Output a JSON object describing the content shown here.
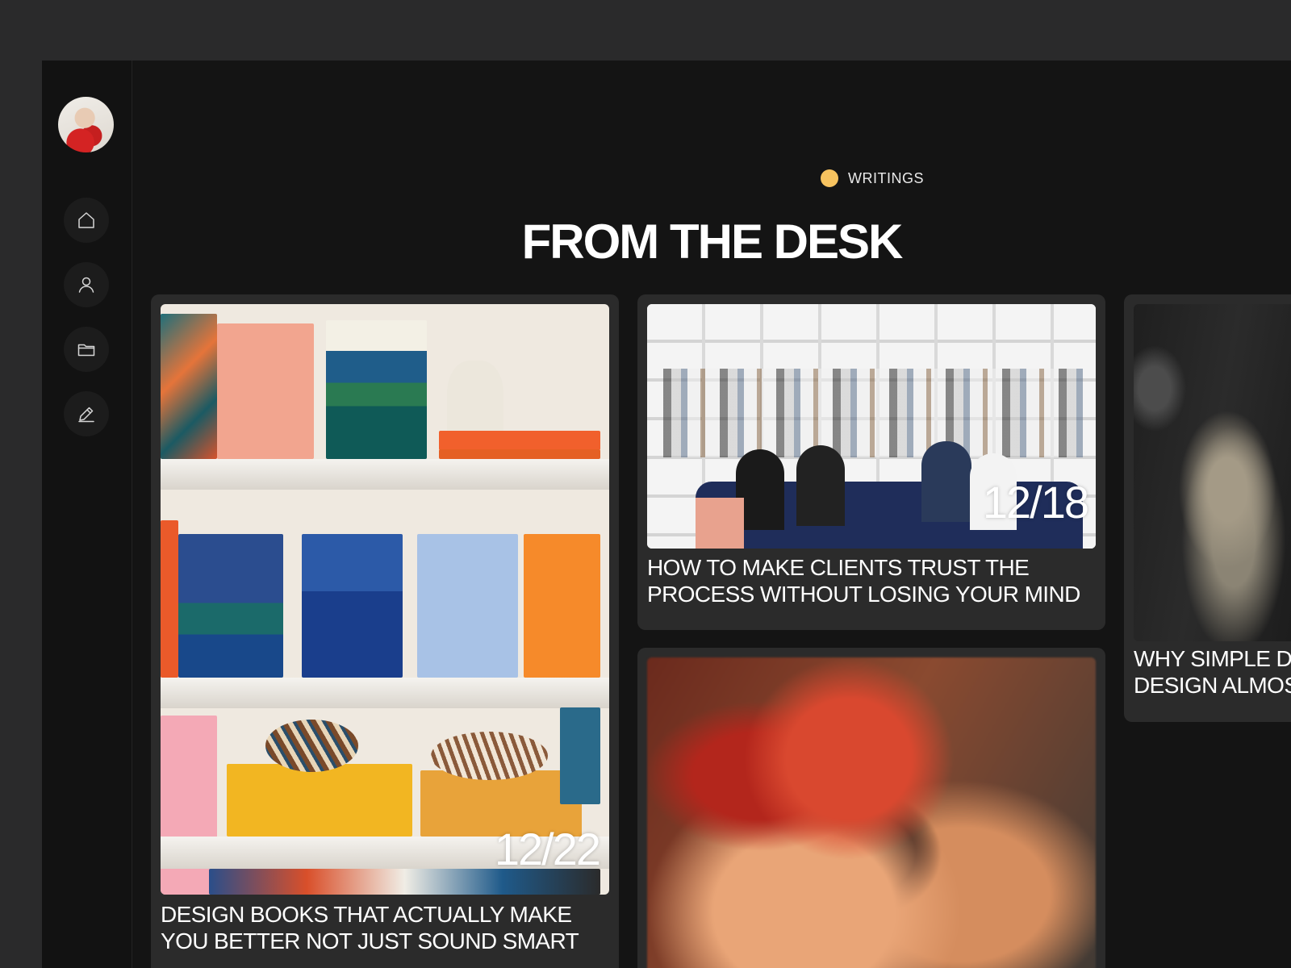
{
  "sidebar": {
    "avatar_alt": "",
    "nav": [
      {
        "name": "home",
        "icon": "home-icon"
      },
      {
        "name": "profile",
        "icon": "user-icon"
      },
      {
        "name": "projects",
        "icon": "folder-icon"
      },
      {
        "name": "writings",
        "icon": "pencil-icon"
      }
    ]
  },
  "header": {
    "eyebrow": "WRITINGS",
    "eyebrow_dot_color": "#f7c35f",
    "title": "FROM THE DESK"
  },
  "cards": [
    {
      "date": "12/22",
      "title_line1": "DESIGN BOOKS THAT ACTUALLY MAKE",
      "title_line2": "YOU BETTER NOT JUST SOUND SMART"
    },
    {
      "date": "12/18",
      "title_line1": "HOW TO MAKE CLIENTS TRUST THE",
      "title_line2": "PROCESS WITHOUT LOSING YOUR MIND"
    },
    {
      "date": "",
      "title_line1": "",
      "title_line2": ""
    },
    {
      "date": "",
      "title_line1": "WHY SIMPLE D",
      "title_line2": "DESIGN ALMOS"
    }
  ]
}
